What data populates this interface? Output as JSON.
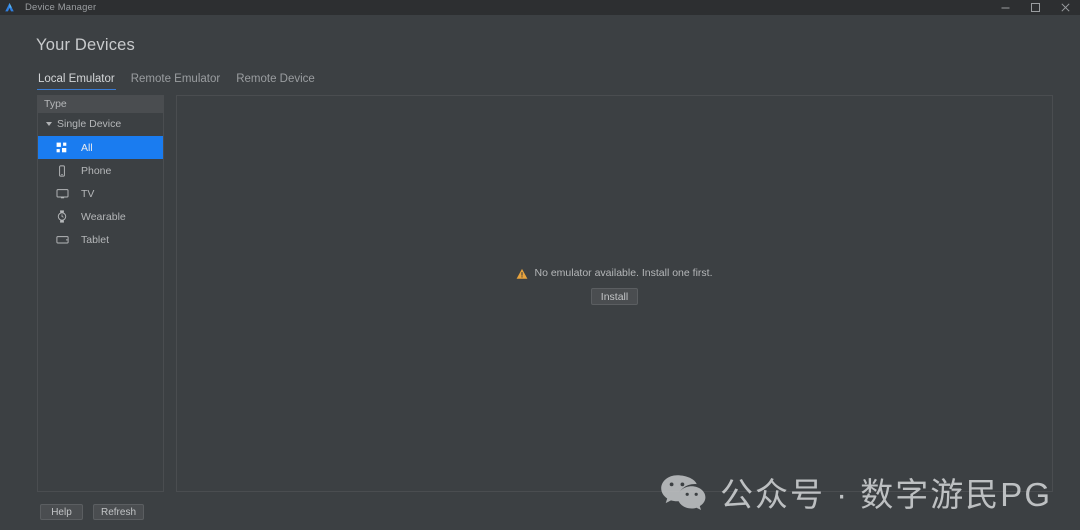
{
  "window": {
    "app_icon": "android-studio-logo-icon",
    "title": "Device Manager",
    "controls": [
      {
        "name": "minimize",
        "icon": "minimize-icon"
      },
      {
        "name": "maximize",
        "icon": "maximize-icon"
      },
      {
        "name": "close",
        "icon": "close-icon"
      }
    ]
  },
  "page": {
    "title": "Your Devices"
  },
  "tabs": [
    {
      "label": "Local Emulator",
      "active": true
    },
    {
      "label": "Remote Emulator",
      "active": false
    },
    {
      "label": "Remote Device",
      "active": false
    }
  ],
  "sidebar": {
    "header": "Type",
    "group": {
      "label": "Single Device",
      "expanded": true,
      "icon": "caret-down-icon"
    },
    "items": [
      {
        "label": "All",
        "icon": "grid-icon",
        "selected": true
      },
      {
        "label": "Phone",
        "icon": "phone-icon",
        "selected": false
      },
      {
        "label": "TV",
        "icon": "tv-icon",
        "selected": false
      },
      {
        "label": "Wearable",
        "icon": "watch-icon",
        "selected": false
      },
      {
        "label": "Tablet",
        "icon": "tablet-icon",
        "selected": false
      }
    ]
  },
  "main": {
    "empty_state": {
      "icon": "warning-triangle-icon",
      "message": "No emulator available. Install one first.",
      "button_label": "Install"
    }
  },
  "footer": {
    "help_label": "Help",
    "refresh_label": "Refresh"
  },
  "watermark": {
    "icon": "wechat-icon",
    "text": "公众号 · 数字游民PG"
  },
  "colors": {
    "window_bg": "#3c4043",
    "titlebar_bg": "#2d2f31",
    "panel_border": "#4a4d50",
    "selection_blue": "#1a7cf0",
    "tab_underline": "#3a7cd4",
    "warning_orange": "#e8a33d",
    "text_primary": "#c8cacc",
    "text_secondary": "#9a9da0"
  }
}
